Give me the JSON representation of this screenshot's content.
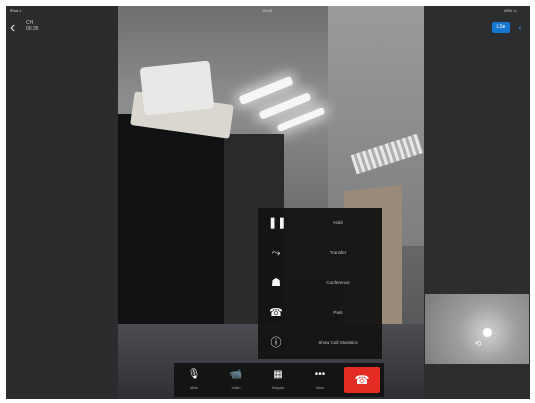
{
  "status_bar": {
    "carrier": "iPad ≈",
    "time": "15:05",
    "battery": "49% ▭"
  },
  "call": {
    "name": "CH",
    "duration": "00:35"
  },
  "top_right": {
    "primary_label": "LSe"
  },
  "icons": {
    "back": "chevron-left-icon",
    "top_right_more": "more-icon",
    "pip_flip": "camera-flip-icon"
  },
  "menu": {
    "items": [
      {
        "label": "Hold",
        "icon": "pause-icon",
        "glyph": "❚❚"
      },
      {
        "label": "Transfer",
        "icon": "transfer-icon",
        "glyph": "⤳"
      },
      {
        "label": "Conference",
        "icon": "conference-icon",
        "glyph": "☗"
      },
      {
        "label": "Park",
        "icon": "park-icon",
        "glyph": "☎"
      },
      {
        "label": "Show Call Statistics",
        "icon": "info-icon",
        "glyph": "ⓘ"
      }
    ]
  },
  "toolbar": {
    "items": [
      {
        "label": "Mute",
        "icon": "mute-icon",
        "glyph": "🎙"
      },
      {
        "label": "Video",
        "icon": "video-icon",
        "glyph": "📹"
      },
      {
        "label": "Keypad",
        "icon": "keypad-icon",
        "glyph": "▦"
      },
      {
        "label": "More",
        "icon": "more-icon",
        "glyph": "•••"
      }
    ],
    "end_call": {
      "icon": "end-call-icon",
      "glyph": "☎"
    }
  },
  "colors": {
    "end_call": "#e52c24",
    "accent_blue": "#1677d1",
    "menu_bg": "#141414"
  }
}
